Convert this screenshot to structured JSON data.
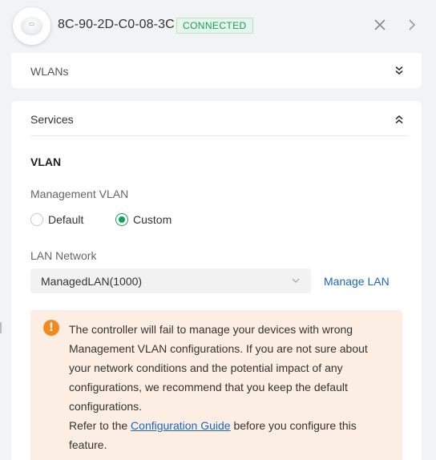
{
  "header": {
    "device_name": "8C-90-2D-C0-08-3C",
    "status": "CONNECTED",
    "icons": {
      "device": "access-point-icon",
      "close": "close-icon",
      "next": "chevron-right-icon"
    },
    "colors": {
      "status_text": "#14a05a",
      "status_bg": "#e6f6ec"
    }
  },
  "wlans": {
    "title": "WLANs",
    "expand_icon": "double-chevron-down-icon"
  },
  "services": {
    "title": "Services",
    "collapse_icon": "double-chevron-up-icon",
    "vlan": {
      "section_title": "VLAN",
      "management_vlan_label": "Management VLAN",
      "options": [
        {
          "label": "Default",
          "checked": false
        },
        {
          "label": "Custom",
          "checked": true
        }
      ],
      "lan_network_label": "LAN Network",
      "lan_network_value": "ManagedLAN(1000)",
      "manage_lan_label": "Manage LAN"
    },
    "alert": {
      "icon": "exclamation-warning-icon",
      "message": "The controller will fail to manage your devices with wrong Management VLAN configurations. If you are not sure about your network conditions and the potential impact of any configurations, we recommend that you keep the default configurations.",
      "refer_prefix": "Refer to the ",
      "guide_link": "Configuration Guide",
      "refer_suffix": " before you configure this feature.",
      "colors": {
        "background": "#fdeee4",
        "icon": "#f28b1d"
      }
    }
  },
  "colors": {
    "accent": "#14a05a",
    "link": "#1767c2",
    "page_bg": "#f2f3f5"
  }
}
